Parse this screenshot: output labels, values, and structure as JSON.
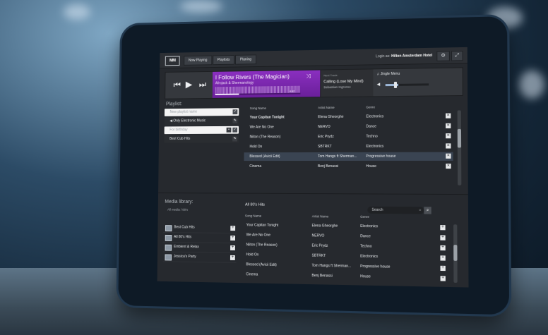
{
  "app": {
    "logo": "MM",
    "nav_tabs": [
      "Now Playing",
      "Playlists",
      "Planing"
    ],
    "login_prefix": "Login as:",
    "login_name": "Hilton Amsterdam Hotel"
  },
  "player": {
    "track_title": "I Follow Rivers (The Magician)",
    "track_artist": "Afrojack & Shermanology",
    "time": "4:02",
    "progress": 0.28,
    "next_label": "Next Track:",
    "next_title": "Calling (Lose My Mind)",
    "next_artist": "Sebastian Ingrosso",
    "jingle_label": "Jingle Menu",
    "volume": 0.3
  },
  "playlists": {
    "label": "Playlist:",
    "new_placeholder": "New playlist name",
    "items": [
      "Only Electronic Music",
      "For birthday",
      "Best Cub Hits"
    ]
  },
  "playlist_table": {
    "headers": [
      "Song Name",
      "Artist Name",
      "Genre"
    ],
    "rows": [
      {
        "song": "Your Capitan Tonight",
        "artist": "Elena Gheorghe",
        "genre": "Electronics"
      },
      {
        "song": "We Are No One",
        "artist": "NERVO",
        "genre": "Dance"
      },
      {
        "song": "Niiton (The Reason)",
        "artist": "Eric Prydz",
        "genre": "Techno"
      },
      {
        "song": "Hold On",
        "artist": "SBTRKT",
        "genre": "Electronics"
      },
      {
        "song": "Blessed (Avicii Edit)",
        "artist": "Tom Hangs ft Sherman...",
        "genre": "Progressive house"
      },
      {
        "song": "Cinema",
        "artist": "Benj Benassi",
        "genre": "House"
      }
    ]
  },
  "library": {
    "label": "Media library:",
    "crumb": "All media / 80's",
    "items": [
      "Best Cub Hits",
      "All 80's Hits",
      "Embient & Relax",
      "Jessica's Party"
    ],
    "current": "All 80's Hits",
    "search_placeholder": "Search",
    "headers": [
      "Song Name",
      "Artist Name",
      "Genre"
    ],
    "rows": [
      {
        "song": "Your Capitan Tonight",
        "artist": "Elena Gheorghe",
        "genre": "Electronics"
      },
      {
        "song": "We Are No One",
        "artist": "NERVO",
        "genre": "Dance"
      },
      {
        "song": "Niiton (The Reason)",
        "artist": "Eric Prydz",
        "genre": "Techno"
      },
      {
        "song": "Hold On",
        "artist": "SBTRKT",
        "genre": "Electronics"
      },
      {
        "song": "Blessed (Avicii Edit)",
        "artist": "Tom Hangs ft Sherman...",
        "genre": "Progressive house"
      },
      {
        "song": "Cinema",
        "artist": "Benj Benassi",
        "genre": "House"
      }
    ]
  },
  "colors": {
    "accent": "#7a28ad",
    "selection": "#3a4452"
  }
}
